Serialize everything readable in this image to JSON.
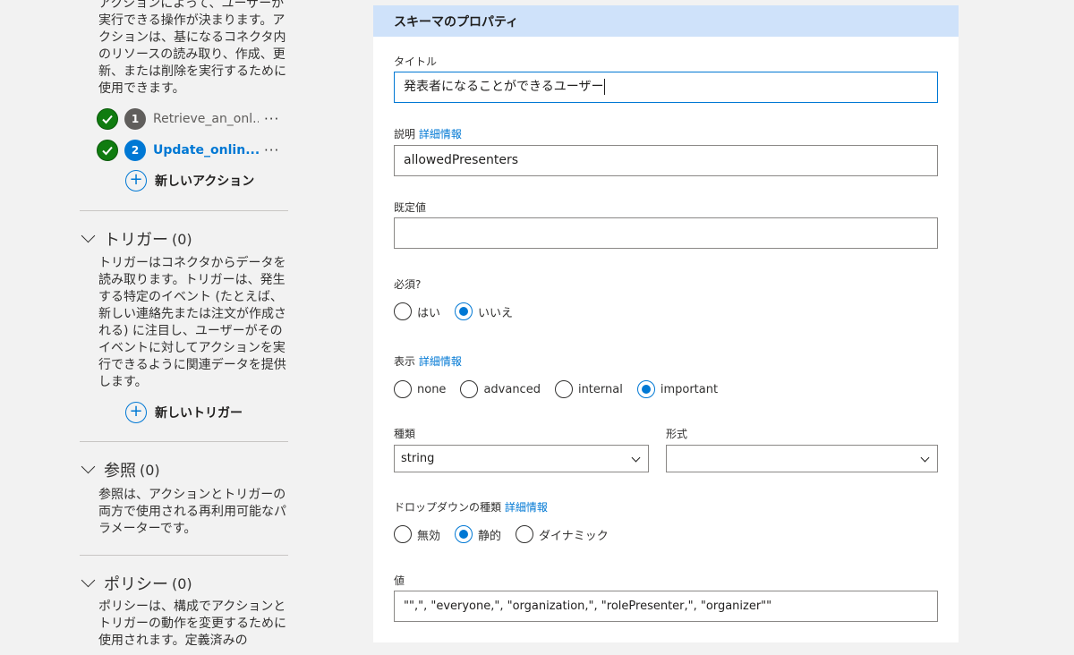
{
  "actions": {
    "description": "アクションによって、ユーザーが実行できる操作が決まります。アクションは、基になるコネクタ内のリソースの読み取り、作成、更新、または削除を実行するために使用できます。",
    "items": [
      {
        "number": "1",
        "label": "Retrieve_an_onl...",
        "more": "···"
      },
      {
        "number": "2",
        "label": "Update_onlin...",
        "more": "···"
      }
    ],
    "new_label": "新しいアクション"
  },
  "triggers": {
    "title": "トリガー",
    "count": "(0)",
    "description": "トリガーはコネクタからデータを読み取ります。トリガーは、発生する特定のイベント (たとえば、新しい連絡先または注文が作成される) に注目し、ユーザーがそのイベントに対してアクションを実行できるように関連データを提供します。",
    "new_label": "新しいトリガー"
  },
  "references": {
    "title": "参照",
    "count": "(0)",
    "description": "参照は、アクションとトリガーの両方で使用される再利用可能なパラメーターです。"
  },
  "policies": {
    "title": "ポリシー",
    "count": "(0)",
    "description": "ポリシーは、構成でアクションとトリガーの動作を変更するために使用されます。定義済みの"
  },
  "schema": {
    "header": "スキーマのプロパティ",
    "title_label": "タイトル",
    "title_value": "発表者になることができるユーザー",
    "desc_label": "説明",
    "desc_link": "詳細情報",
    "desc_value": "allowedPresenters",
    "default_label": "既定値",
    "default_value": "",
    "required_label": "必須?",
    "required_options": [
      "はい",
      "いいえ"
    ],
    "visibility_label": "表示",
    "visibility_link": "詳細情報",
    "visibility_options": [
      "none",
      "advanced",
      "internal",
      "important"
    ],
    "type_label": "種類",
    "type_value": "string",
    "format_label": "形式",
    "format_value": "",
    "dropdown_label": "ドロップダウンの種類",
    "dropdown_link": "詳細情報",
    "dropdown_options": [
      "無効",
      "静的",
      "ダイナミック"
    ],
    "values_label": "値",
    "values_value": "\"\",\", \"everyone,\", \"organization,\", \"rolePresenter,\", \"organizer\"\""
  },
  "selected": {
    "required": "いいえ",
    "visibility": "important",
    "dropdown": "静的"
  }
}
